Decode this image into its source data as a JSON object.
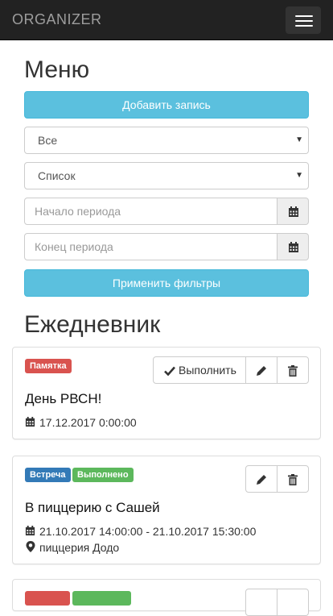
{
  "navbar": {
    "brand": "ORGANIZER"
  },
  "menu": {
    "title": "Меню",
    "add_button": "Добавить запись",
    "filter_type": "Все",
    "view_mode": "Список",
    "start_placeholder": "Начало периода",
    "end_placeholder": "Конец периода",
    "apply_button": "Применить фильтры"
  },
  "diary": {
    "title": "Ежедневник",
    "complete_label": "Выполнить",
    "entries": [
      {
        "labels": [
          "Памятка"
        ],
        "title": "День РВСН!",
        "datetime": "17.12.2017 0:00:00"
      },
      {
        "labels": [
          "Встреча",
          "Выполнено"
        ],
        "title": "В пиццерию с Сашей",
        "datetime": "21.10.2017 14:00:00 - 21.10.2017 15:30:00",
        "location": "пиццерия Додо"
      }
    ]
  },
  "colors": {
    "info": "#5bc0de",
    "danger": "#d9534f",
    "primary": "#337ab7",
    "success": "#5cb85c",
    "navbar": "#222222"
  }
}
